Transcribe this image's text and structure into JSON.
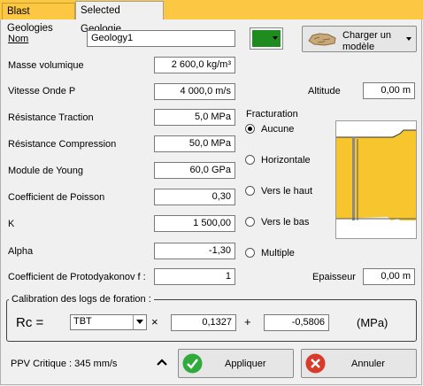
{
  "tabs": [
    {
      "label": "Blast Geologies"
    },
    {
      "label": "Selected Geologie"
    }
  ],
  "name": {
    "label": "Nom",
    "value": "Geology1"
  },
  "color_swatch": "#1e8c1e",
  "load_model_button": {
    "label": "Charger un modèle"
  },
  "params": [
    {
      "label": "Masse volumique",
      "value": "2 600,0 kg/m³"
    },
    {
      "label": "Vitesse Onde P",
      "value": "4 000,0 m/s"
    },
    {
      "label": "Résistance Traction",
      "value": "5,0 MPa"
    },
    {
      "label": "Résistance Compression",
      "value": "50,0 MPa"
    },
    {
      "label": "Module de Young",
      "value": "60,0 GPa"
    },
    {
      "label": "Coefficient de Poisson",
      "value": "0,30"
    },
    {
      "label": "K",
      "value": "1 500,00"
    },
    {
      "label": "Alpha",
      "value": "-1,30"
    },
    {
      "label": "Coefficient de Protodyakonov f :",
      "value": "1"
    }
  ],
  "altitude": {
    "label": "Altitude",
    "value": "0,00 m"
  },
  "fracturation": {
    "label": "Fracturation",
    "options": [
      "Aucune",
      "Horizontale",
      "Vers le haut",
      "Vers le bas",
      "Multiple"
    ],
    "selected": "Aucune"
  },
  "epaisseur": {
    "label": "Epaisseur",
    "value": "0,00 m"
  },
  "calibration": {
    "title": "Calibration des logs de foration :",
    "rc_label": "Rc =",
    "select_value": "TBT",
    "times": "×",
    "coef": "0,1327",
    "plus": "+",
    "offset": "-0,5806",
    "unit": "(MPa)"
  },
  "ppv": {
    "label": "PPV Critique : 345 mm/s"
  },
  "apply_button": {
    "label": "Appliquer"
  },
  "cancel_button": {
    "label": "Annuler"
  },
  "colors": {
    "tab_yellow": "#fcc844",
    "apply_green": "#2eab3a",
    "cancel_red": "#d93b2b",
    "preview_yellow": "#f7c62f"
  }
}
